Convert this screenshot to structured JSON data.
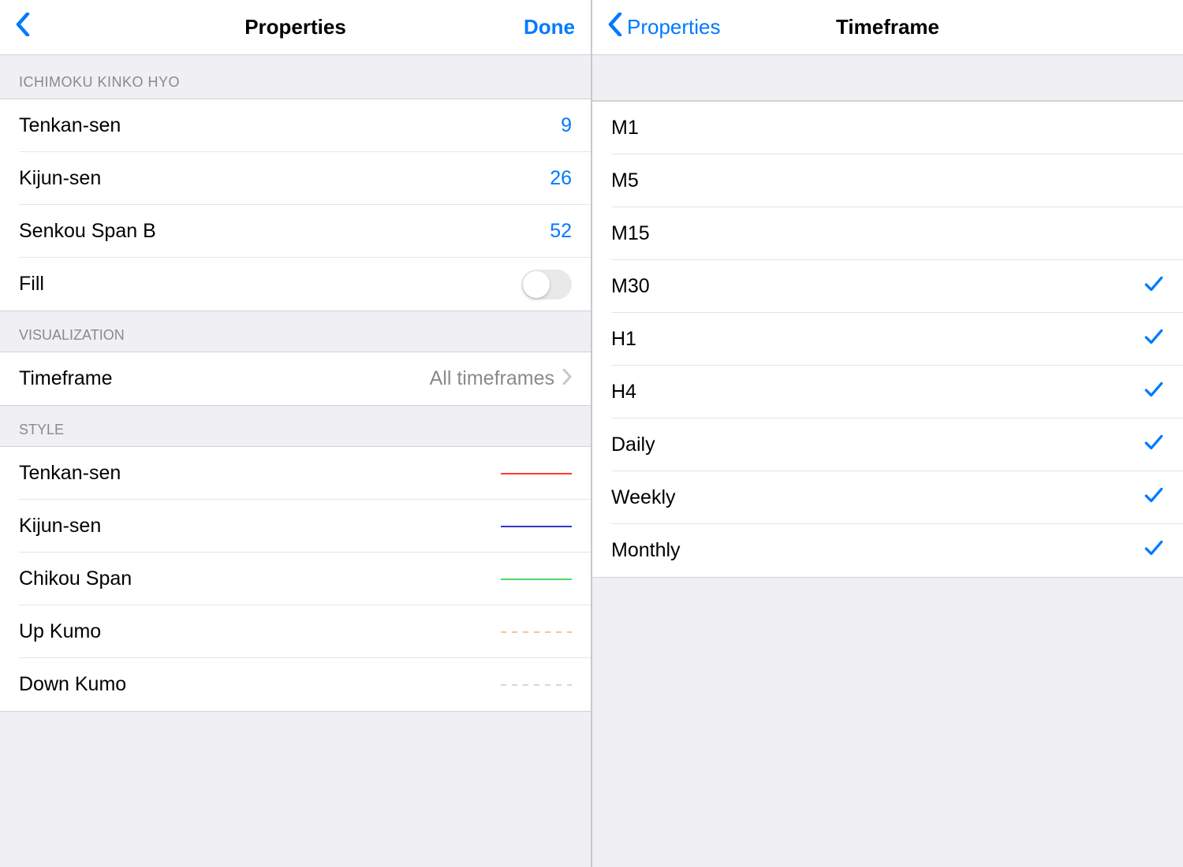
{
  "left": {
    "title": "Properties",
    "done_label": "Done",
    "sections": {
      "ichimoku": {
        "header": "ICHIMOKU KINKO HYO",
        "tenkan_label": "Tenkan-sen",
        "tenkan_value": "9",
        "kijun_label": "Kijun-sen",
        "kijun_value": "26",
        "senkou_label": "Senkou Span B",
        "senkou_value": "52",
        "fill_label": "Fill",
        "fill_on": false
      },
      "visualization": {
        "header": "VISUALIZATION",
        "timeframe_label": "Timeframe",
        "timeframe_value": "All timeframes"
      },
      "style": {
        "header": "STYLE",
        "items": [
          {
            "label": "Tenkan-sen",
            "color": "#ff3b30",
            "dashed": false
          },
          {
            "label": "Kijun-sen",
            "color": "#3333cc",
            "dashed": false
          },
          {
            "label": "Chikou Span",
            "color": "#4cd964",
            "dashed": false
          },
          {
            "label": "Up Kumo",
            "color": "#f5c49a",
            "dashed": true
          },
          {
            "label": "Down Kumo",
            "color": "#d7d7db",
            "dashed": true
          }
        ]
      }
    }
  },
  "right": {
    "back_label": "Properties",
    "title": "Timeframe",
    "items": [
      {
        "label": "M1",
        "checked": false
      },
      {
        "label": "M5",
        "checked": false
      },
      {
        "label": "M15",
        "checked": false
      },
      {
        "label": "M30",
        "checked": true
      },
      {
        "label": "H1",
        "checked": true
      },
      {
        "label": "H4",
        "checked": true
      },
      {
        "label": "Daily",
        "checked": true
      },
      {
        "label": "Weekly",
        "checked": true
      },
      {
        "label": "Monthly",
        "checked": true
      }
    ]
  },
  "colors": {
    "accent": "#007aff"
  }
}
